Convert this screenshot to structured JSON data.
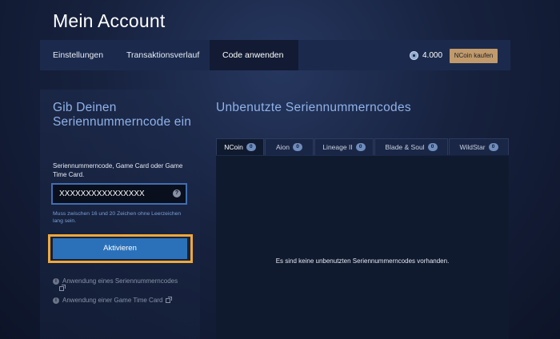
{
  "page": {
    "title": "Mein Account"
  },
  "nav": {
    "tabs": [
      {
        "label": "Einstellungen"
      },
      {
        "label": "Transaktionsverlauf"
      },
      {
        "label": "Code anwenden",
        "active": true
      }
    ],
    "balance": "4.000",
    "balance_icon": "ncoin-icon",
    "buy_label": "NCoin kaufen"
  },
  "redeem": {
    "title": "Gib Deinen Seriennummerncode ein",
    "field_label": "Seriennummerncode, Game Card oder Game Time Card.",
    "code_value": "XXXXXXXXXXXXXXXX",
    "help_icon": "?",
    "hint": "Muss zwischen 16 und 20 Zeichen ohne Leerzeichen lang sein.",
    "activate_label": "Aktivieren",
    "links": [
      {
        "label": "Anwendung eines Seriennummerncodes"
      },
      {
        "label": "Anwendung einer Game Time Card"
      }
    ]
  },
  "codes": {
    "title": "Unbenutzte Seriennummerncodes",
    "tabs": [
      {
        "label": "NCoin",
        "count": "0",
        "active": true
      },
      {
        "label": "Aion",
        "count": "0"
      },
      {
        "label": "Lineage II",
        "count": "0"
      },
      {
        "label": "Blade & Soul",
        "count": "0"
      },
      {
        "label": "WildStar",
        "count": "0"
      }
    ],
    "empty_message": "Es sind keine unbenutzten Seriennummerncodes vorhanden."
  },
  "colors": {
    "accent_blue": "#2b71b9",
    "highlight_orange": "#f0a83a",
    "buy_button": "#c19a6b",
    "heading_blue": "#8fb2e8"
  }
}
